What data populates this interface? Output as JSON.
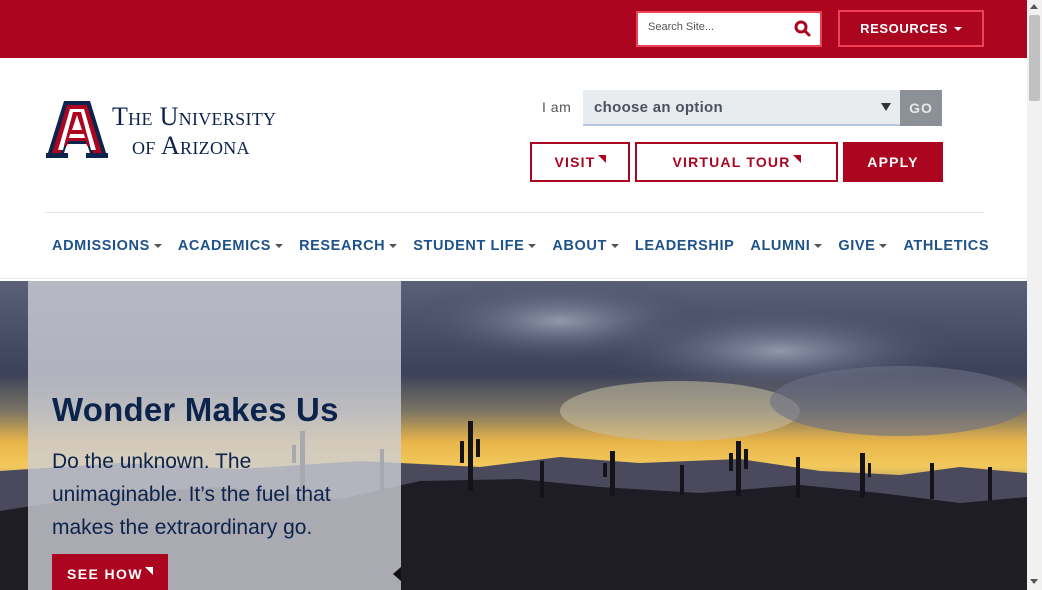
{
  "colors": {
    "brand_red": "#ab0520",
    "bloom_red": "#ef4056",
    "navy": "#0c234b",
    "nav_blue": "#1e5288",
    "go_gray": "#8b9196"
  },
  "topbar": {
    "search_placeholder": "Search Site...",
    "search_icon": "search-icon",
    "resources_label": "RESOURCES"
  },
  "logo": {
    "line1": "The University",
    "line2": "of Arizona",
    "mark_letter": "A"
  },
  "audience": {
    "label": "I am",
    "selected": "choose an option",
    "go_label": "GO"
  },
  "cta": {
    "visit": "VISIT",
    "virtual_tour": "VIRTUAL TOUR",
    "apply": "APPLY"
  },
  "nav": {
    "items": [
      {
        "label": "ADMISSIONS",
        "has_caret": true
      },
      {
        "label": "ACADEMICS",
        "has_caret": true
      },
      {
        "label": "RESEARCH",
        "has_caret": true
      },
      {
        "label": "STUDENT LIFE",
        "has_caret": true
      },
      {
        "label": "ABOUT",
        "has_caret": true
      },
      {
        "label": "LEADERSHIP",
        "has_caret": false
      },
      {
        "label": "ALUMNI",
        "has_caret": true
      },
      {
        "label": "GIVE",
        "has_caret": true
      },
      {
        "label": "ATHLETICS",
        "has_caret": false
      }
    ]
  },
  "hero": {
    "title": "Wonder Makes Us",
    "body": "Do the unknown. The unimaginable. It’s the fuel that makes the extraordinary go.",
    "cta": "SEE HOW"
  }
}
